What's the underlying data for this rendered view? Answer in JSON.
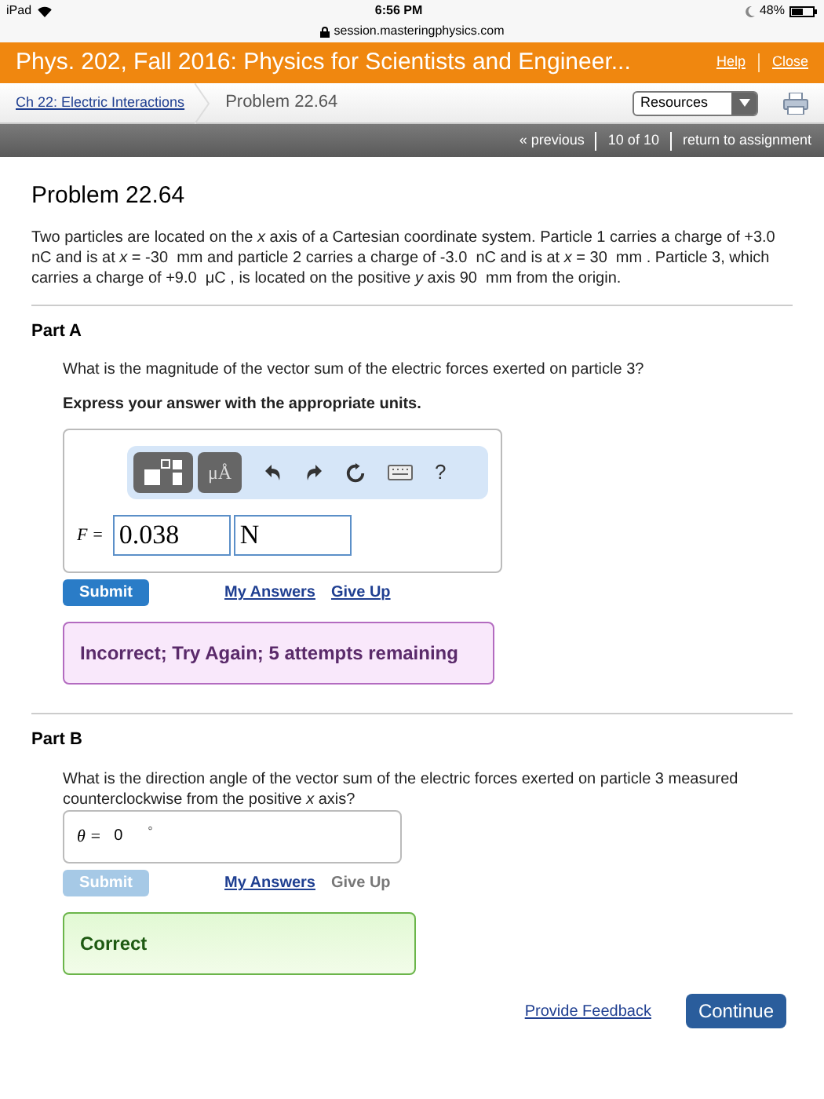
{
  "status_bar": {
    "device": "iPad",
    "time": "6:56 PM",
    "battery": "48%",
    "url": "session.masteringphysics.com"
  },
  "header": {
    "title": "Phys. 202, Fall 2016: Physics for Scientists and Engineer...",
    "links": [
      "Help",
      "Close"
    ]
  },
  "breadcrumb": {
    "link": "Ch 22: Electric Interactions",
    "current": "Problem 22.64",
    "resources": "Resources"
  },
  "nav": {
    "previous": "« previous",
    "position": "10 of 10",
    "return": "return to assignment"
  },
  "problem": {
    "title": "Problem 22.64",
    "text": "Two particles are located on the *x* axis of a Cartesian coordinate system. Particle 1 carries a charge of +3.0  nC and is at *x* = -30  mm and particle 2 carries a charge of -3.0  nC and is at *x* = 30  mm . Particle 3, which carries a charge of +9.0  μC , is located on the positive *y* axis 90  mm from the origin."
  },
  "parts": [
    {
      "title": "Part A",
      "question": "What is the magnitude of the vector sum of the electric forces exerted on particle 3?",
      "instruction": "Express your answer with the appropriate units.",
      "toolbar": {
        "units_label": "μÅ",
        "help": "?"
      },
      "variable": "F =",
      "value": "0.038",
      "unit": "N",
      "submit": {
        "label": "Submit",
        "disabled": false
      },
      "links": [
        {
          "label": "My Answers",
          "disabled": false
        },
        {
          "label": "Give Up",
          "disabled": false
        }
      ],
      "feedback": {
        "kind": "incorrect",
        "text": "Incorrect; Try Again; 5 attempts remaining"
      }
    },
    {
      "title": "Part B",
      "question": "What is the direction angle of the vector sum of the electric forces exerted on particle 3 measured counterclockwise from the positive *x* axis?",
      "variable": "θ =",
      "value": "0",
      "unit": "°",
      "submit": {
        "label": "Submit",
        "disabled": true
      },
      "links": [
        {
          "label": "My Answers",
          "disabled": false
        },
        {
          "label": "Give Up",
          "disabled": true
        }
      ],
      "feedback": {
        "kind": "correct",
        "text": "Correct"
      }
    }
  ],
  "footer": {
    "feedback_link": "Provide Feedback",
    "continue": "Continue"
  }
}
